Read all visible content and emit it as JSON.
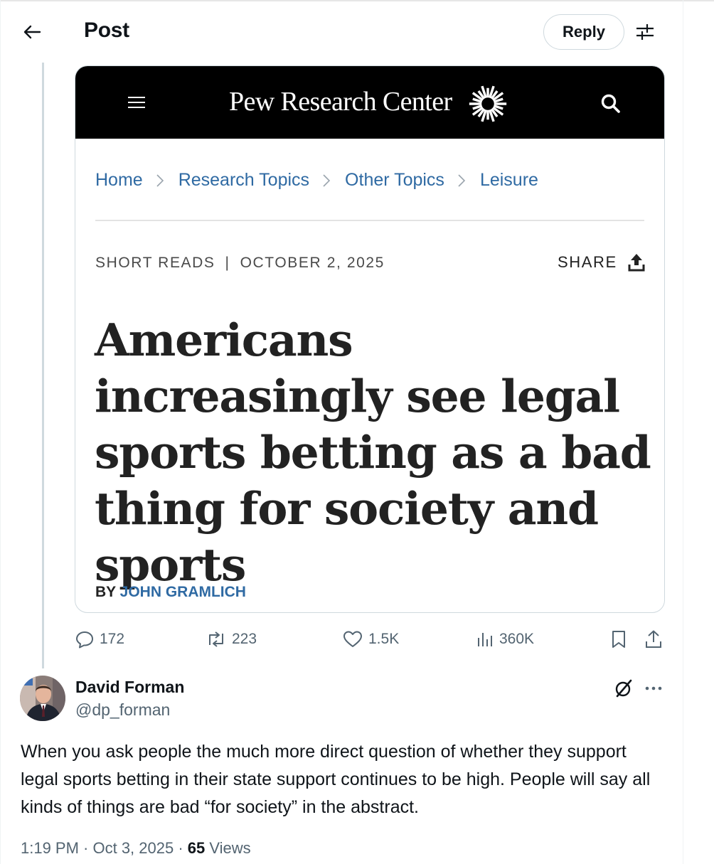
{
  "header": {
    "title": "Post",
    "reply_label": "Reply"
  },
  "card": {
    "site_name": "Pew Research Center",
    "breadcrumbs": [
      "Home",
      "Research Topics",
      "Other Topics",
      "Leisure"
    ],
    "category": "SHORT READS",
    "separator": "|",
    "date": "OCTOBER 2, 2025",
    "share_label": "SHARE",
    "headline": "Americans increasingly see legal sports betting as a bad thing for society and sports",
    "byline_prefix": "BY",
    "author": "JOHN GRAMLICH"
  },
  "actions": {
    "replies": "172",
    "reposts": "223",
    "likes": "1.5K",
    "views": "360K"
  },
  "reply": {
    "name": "David Forman",
    "handle": "@dp_forman",
    "text": "When you ask people the much more direct question of whether they support legal sports betting in their state support continues to be high. People will say all kinds of things are bad “for society” in the abstract.",
    "time": "1:19 PM · Oct 3, 2025 · ",
    "views_count": "65",
    "views_label": " Views"
  },
  "icons": {
    "back": "arrow-left-icon",
    "filter": "sliders-icon",
    "menu": "hamburger-menu-icon",
    "logo": "pew-starburst-logo",
    "search": "search-icon",
    "breadcrumb_sep": "chevron-right-icon",
    "share": "share-upload-icon",
    "reply": "speech-bubble-icon",
    "repost": "repost-arrows-icon",
    "like": "heart-icon",
    "views": "bar-chart-icon",
    "bookmark": "bookmark-icon",
    "upload": "upload-icon",
    "grok": "grok-icon",
    "more": "more-dots-icon"
  },
  "colors": {
    "link_blue": "#2f6aa3",
    "x_gray": "#536471",
    "text": "#0f1419",
    "pew_black": "#000000"
  }
}
